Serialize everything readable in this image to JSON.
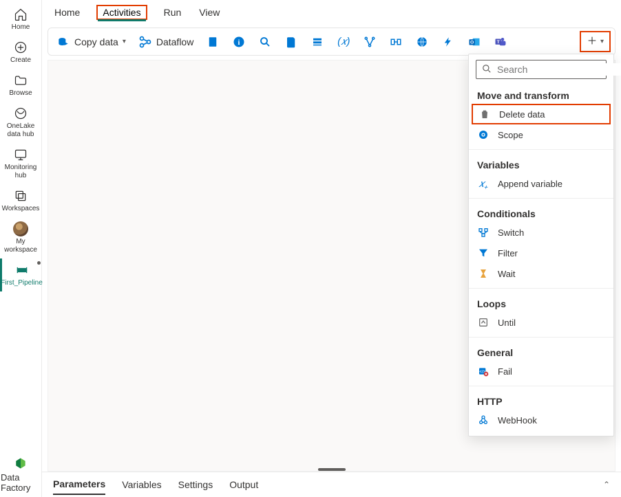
{
  "nav": {
    "home": "Home",
    "create": "Create",
    "browse": "Browse",
    "onelake": "OneLake data hub",
    "monitoring": "Monitoring hub",
    "workspaces": "Workspaces",
    "myworkspace": "My workspace",
    "firstpipeline": "First_Pipeline",
    "datafactory": "Data Factory"
  },
  "tabs": {
    "home": "Home",
    "activities": "Activities",
    "run": "Run",
    "view": "View"
  },
  "ribbon": {
    "copydata": "Copy data",
    "dataflow": "Dataflow"
  },
  "panel": {
    "search_placeholder": "Search",
    "cat_move": "Move and transform",
    "delete": "Delete data",
    "scope": "Scope",
    "cat_vars": "Variables",
    "append": "Append variable",
    "cat_cond": "Conditionals",
    "switch": "Switch",
    "filter": "Filter",
    "wait": "Wait",
    "cat_loops": "Loops",
    "until": "Until",
    "cat_general": "General",
    "fail": "Fail",
    "cat_http": "HTTP",
    "webhook": "WebHook"
  },
  "footer": {
    "parameters": "Parameters",
    "variables": "Variables",
    "settings": "Settings",
    "output": "Output"
  },
  "colors": {
    "highlight_red": "#e23c00",
    "accent_teal": "#0f7b6b",
    "ms_blue": "#0078d4"
  }
}
